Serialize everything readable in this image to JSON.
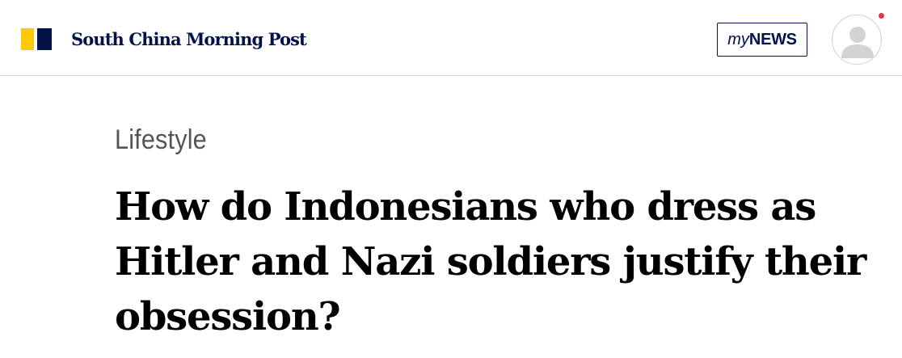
{
  "header": {
    "site_name": "South China Morning Post",
    "mynews": {
      "prefix": "my",
      "suffix": "NEWS"
    },
    "avatar_icon": "user-avatar-icon",
    "notification_color": "#e6334a",
    "brand_colors": {
      "yellow": "#ffca05",
      "navy": "#001246"
    }
  },
  "article": {
    "section": "Lifestyle",
    "headline": "How do Indonesians who dress as Hitler and Nazi soldiers justify their obsession?"
  }
}
